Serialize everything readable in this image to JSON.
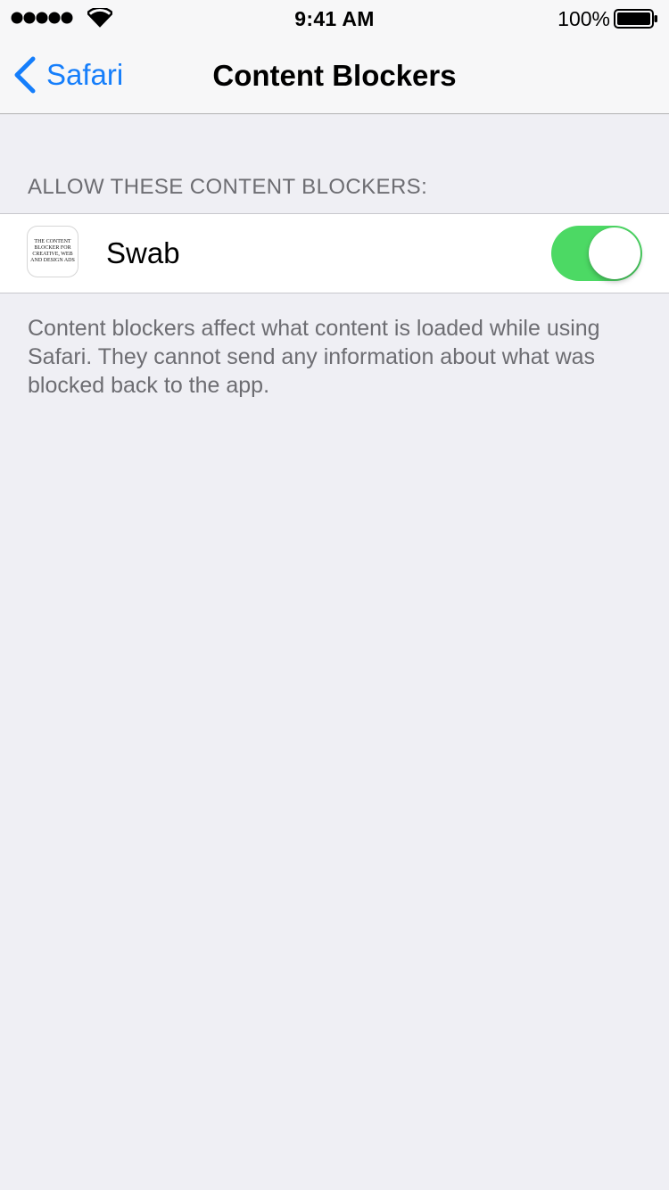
{
  "status_bar": {
    "time": "9:41 AM",
    "battery_percent": "100%",
    "signal_icon": "signal-dots-icon",
    "wifi_icon": "wifi-icon",
    "battery_icon": "battery-full-icon"
  },
  "nav": {
    "back_label": "Safari",
    "back_icon": "chevron-left-icon",
    "title": "Content Blockers"
  },
  "section": {
    "header": "ALLOW THESE CONTENT BLOCKERS:",
    "items": [
      {
        "app_name": "Swab",
        "icon_text": "THE CONTENT BLOCKER FOR CREATIVE, WEB AND DESIGN ADS",
        "enabled": true
      }
    ],
    "footer": "Content blockers affect what content is loaded while using Safari. They cannot send any information about what was blocked back to the app."
  },
  "colors": {
    "accent": "#157efb",
    "toggle_on": "#4cd964",
    "background": "#efeff4",
    "secondary_text": "#6d6d72"
  }
}
